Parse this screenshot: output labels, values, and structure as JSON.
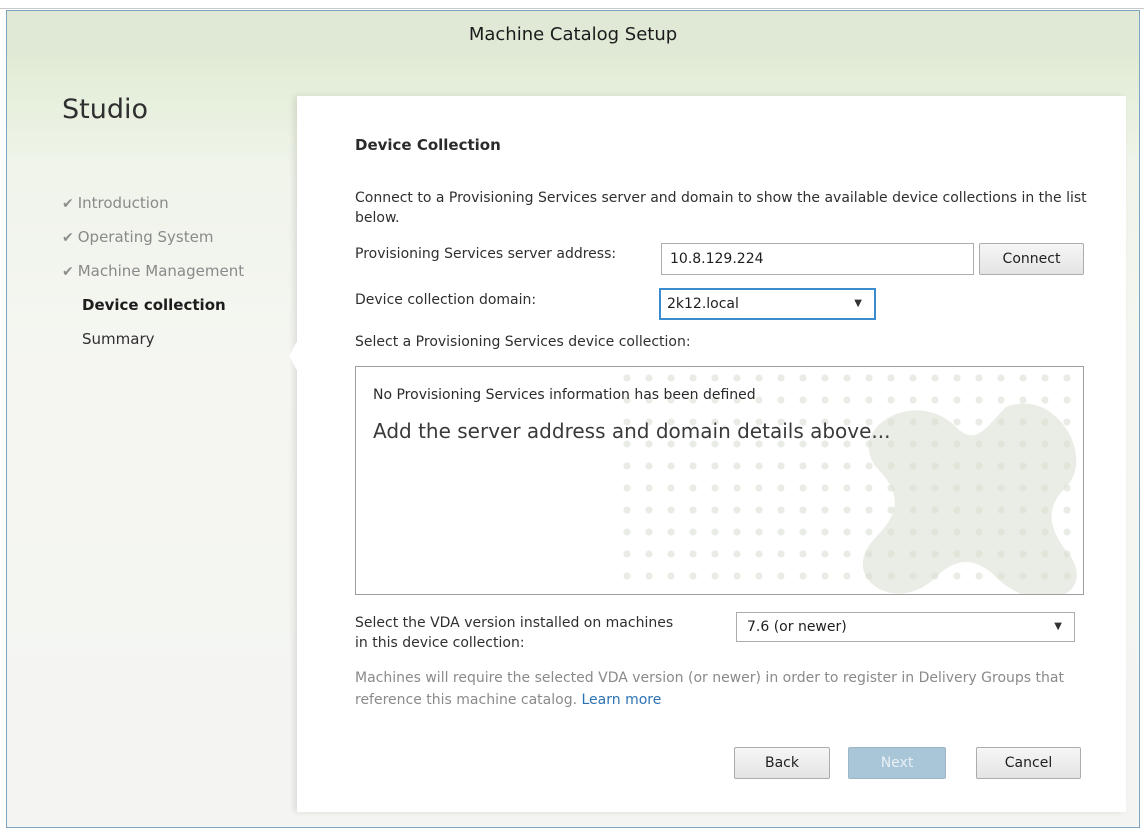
{
  "window": {
    "title": "Machine Catalog Setup"
  },
  "sidebar": {
    "product": "Studio",
    "steps": [
      {
        "label": "Introduction",
        "done_mark": "✔"
      },
      {
        "label": "Operating System",
        "done_mark": "✔"
      },
      {
        "label": "Machine Management",
        "done_mark": "✔"
      },
      {
        "label": "Device collection"
      },
      {
        "label": "Summary"
      }
    ]
  },
  "main": {
    "title": "Device Collection",
    "description": "Connect to a Provisioning Services server and domain to show the available device collections in the list below.",
    "server": {
      "label": "Provisioning Services server address:",
      "value": "10.8.129.224",
      "connect_label": "Connect"
    },
    "domain": {
      "label": "Device collection domain:",
      "selected": "2k12.local"
    },
    "collection": {
      "label": "Select a Provisioning Services device collection:",
      "empty_title": "No Provisioning Services information has been defined",
      "empty_hint": "Add the server address and domain details above..."
    },
    "vda": {
      "label_line1": "Select the VDA version installed on machines",
      "label_line2": "in this device collection:",
      "selected": "7.6 (or newer)"
    },
    "help_text": "Machines will require the selected VDA version (or newer) in order to register in Delivery Groups that reference this machine catalog.",
    "help_link": "Learn more"
  },
  "footer": {
    "back_label": "Back",
    "next_label": "Next",
    "cancel_label": "Cancel"
  }
}
